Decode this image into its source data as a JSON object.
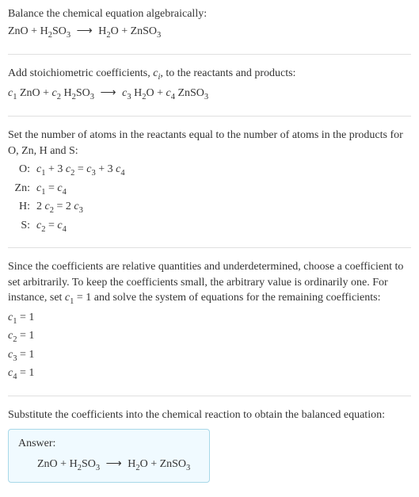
{
  "section1": {
    "title": "Balance the chemical equation algebraically:",
    "reactant1": "ZnO",
    "plus": "+",
    "reactant2_a": "H",
    "reactant2_b": "2",
    "reactant2_c": "SO",
    "reactant2_d": "3",
    "arrow": "⟶",
    "product1_a": "H",
    "product1_b": "2",
    "product1_c": "O",
    "product2_a": "ZnSO",
    "product2_b": "3"
  },
  "section2": {
    "title_a": "Add stoichiometric coefficients, ",
    "title_b": "c",
    "title_c": "i",
    "title_d": ", to the reactants and products:",
    "c1": "c",
    "c1s": "1",
    "r1": " ZnO",
    "plus": "+",
    "c2": "c",
    "c2s": "2",
    "r2a": " H",
    "r2b": "2",
    "r2c": "SO",
    "r2d": "3",
    "arrow": "⟶",
    "c3": "c",
    "c3s": "3",
    "p1a": " H",
    "p1b": "2",
    "p1c": "O",
    "c4": "c",
    "c4s": "4",
    "p2a": " ZnSO",
    "p2b": "3"
  },
  "section3": {
    "title": "Set the number of atoms in the reactants equal to the number of atoms in the products for O, Zn, H and S:",
    "rows": {
      "o_label": "O:",
      "o_eq_a": "c",
      "o_eq_b": "1",
      "o_eq_c": " + 3 ",
      "o_eq_d": "c",
      "o_eq_e": "2",
      "o_eq_f": " = ",
      "o_eq_g": "c",
      "o_eq_h": "3",
      "o_eq_i": " + 3 ",
      "o_eq_j": "c",
      "o_eq_k": "4",
      "zn_label": "Zn:",
      "zn_eq_a": "c",
      "zn_eq_b": "1",
      "zn_eq_c": " = ",
      "zn_eq_d": "c",
      "zn_eq_e": "4",
      "h_label": "H:",
      "h_eq_a": "2 ",
      "h_eq_b": "c",
      "h_eq_c": "2",
      "h_eq_d": " = 2 ",
      "h_eq_e": "c",
      "h_eq_f": "3",
      "s_label": "S:",
      "s_eq_a": "c",
      "s_eq_b": "2",
      "s_eq_c": " = ",
      "s_eq_d": "c",
      "s_eq_e": "4"
    }
  },
  "section4": {
    "title_a": "Since the coefficients are relative quantities and underdetermined, choose a coefficient to set arbitrarily. To keep the coefficients small, the arbitrary value is ordinarily one. For instance, set ",
    "title_b": "c",
    "title_c": "1",
    "title_d": " = 1 and solve the system of equations for the remaining coefficients:",
    "c1a": "c",
    "c1b": "1",
    "c1c": " = 1",
    "c2a": "c",
    "c2b": "2",
    "c2c": " = 1",
    "c3a": "c",
    "c3b": "3",
    "c3c": " = 1",
    "c4a": "c",
    "c4b": "4",
    "c4c": " = 1"
  },
  "section5": {
    "title": "Substitute the coefficients into the chemical reaction to obtain the balanced equation:",
    "answer_label": "Answer:",
    "r1": "ZnO",
    "plus": "+",
    "r2a": "H",
    "r2b": "2",
    "r2c": "SO",
    "r2d": "3",
    "arrow": "⟶",
    "p1a": "H",
    "p1b": "2",
    "p1c": "O",
    "p2a": "ZnSO",
    "p2b": "3"
  }
}
